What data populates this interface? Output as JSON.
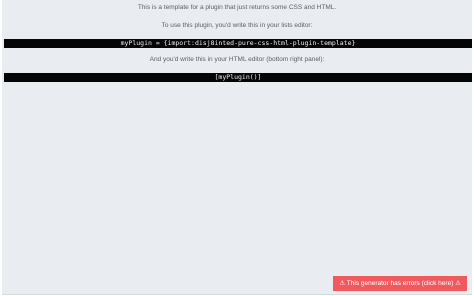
{
  "content": {
    "intro_text": "This is a template for a plugin that just returns some CSS and HTML.",
    "lists_instruction": "To use this plugin, you'd write this in your lists editor:",
    "lists_code": "myPlugin = {import:disj8inted-pure-css-html-plugin-template}",
    "html_instruction": "And you'd write this in your HTML editor (bottom right panel):",
    "html_code": "[myPlugin()]"
  },
  "error_banner": {
    "label": "⚠ This generator has errors (click here) ⚠",
    "color": "#f05a5f"
  }
}
